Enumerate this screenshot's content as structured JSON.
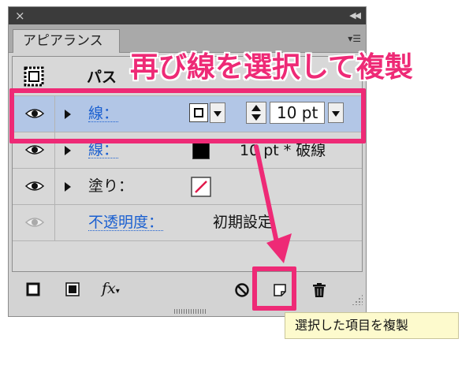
{
  "panel": {
    "tab_label": "アピアランス"
  },
  "header_row": {
    "label": "パス"
  },
  "rows": [
    {
      "label": "線：",
      "value": "10 pt",
      "selected": true
    },
    {
      "label": "線：",
      "value": "10 pt * 破線"
    },
    {
      "label": "塗り："
    },
    {
      "label": "不透明度：",
      "value": "初期設定"
    }
  ],
  "footer": {
    "fx_label": "fx"
  },
  "annotation": {
    "title": "再び線を選択して複製",
    "color": "#ee2a76"
  },
  "tooltip": {
    "text": "選択した項目を複製"
  },
  "colors": {
    "selected_row": "#b2c6e6",
    "link_label": "#1a5fd0"
  }
}
